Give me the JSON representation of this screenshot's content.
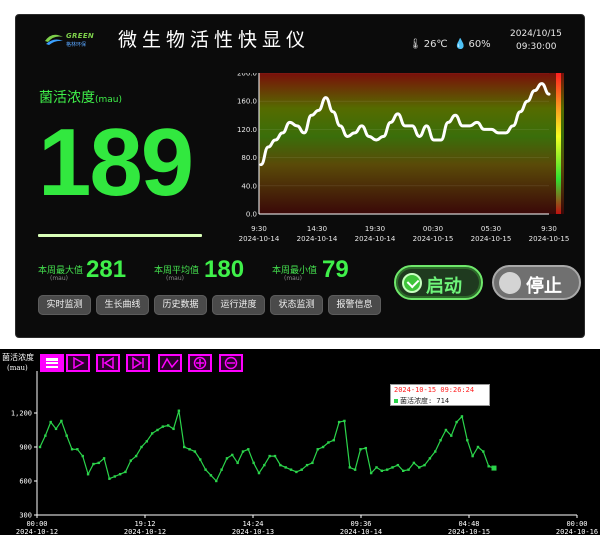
{
  "header": {
    "logo_text": "GREEN",
    "logo_sub": "格林环保",
    "title": "微生物活性快显仪",
    "temperature": "26℃",
    "humidity": "60%",
    "date": "2024/10/15",
    "time": "09:30:00",
    "thermometer_icon": "thermometer-icon",
    "droplet_icon": "droplet-icon"
  },
  "metric": {
    "label": "菌活浓度",
    "unit": "(mau)",
    "value": "189"
  },
  "stats": [
    {
      "label": "本周最大值",
      "unit": "(mau)",
      "value": "281"
    },
    {
      "label": "本周平均值",
      "unit": "(mau)",
      "value": "180"
    },
    {
      "label": "本周最小值",
      "unit": "(mau)",
      "value": "79"
    }
  ],
  "nav": [
    "实时监测",
    "生长曲线",
    "历史数据",
    "运行进度",
    "状态监测",
    "报警信息"
  ],
  "controls": {
    "start_label": "启动",
    "stop_label": "停止"
  },
  "colors": {
    "accent_green": "#32e83f",
    "panel_bg": "#0b0b0b",
    "toolbar_magenta": "#ff00ff",
    "series_green": "#2bd44b"
  },
  "chart_data": [
    {
      "type": "line",
      "ylim": [
        0,
        2000
      ],
      "yticks": [
        "0.0",
        "40.0",
        "80.0",
        "120.0",
        "160.0",
        "200.0"
      ],
      "xtick_labels": [
        {
          "time": "9:30",
          "date": "2024-10-14"
        },
        {
          "time": "14:30",
          "date": "2024-10-14"
        },
        {
          "time": "19:30",
          "date": "2024-10-14"
        },
        {
          "time": "00:30",
          "date": "2024-10-15"
        },
        {
          "time": "05:30",
          "date": "2024-10-15"
        },
        {
          "time": "9:30",
          "date": "2024-10-15"
        }
      ],
      "series": [
        {
          "values": [
            700,
            950,
            1050,
            1150,
            1300,
            1250,
            1150,
            1400,
            1470,
            1650,
            1450,
            1250,
            1100,
            1150,
            1250,
            1100,
            1050,
            1100,
            1300,
            1420,
            1250,
            1250,
            1100,
            1250,
            1050,
            1050,
            1300,
            1400,
            1250,
            1250,
            1300,
            1200,
            1200,
            1150,
            1150,
            1250,
            1450,
            1600,
            1750,
            1850,
            1700
          ]
        }
      ],
      "grid": true
    },
    {
      "type": "line",
      "title": "菌活浓度",
      "ylabel": "(mau)",
      "ylim": [
        300,
        1500
      ],
      "yticks": [
        300,
        600,
        900,
        1200
      ],
      "xtick_labels": [
        {
          "time": "00:00",
          "date": "2024-10-12"
        },
        {
          "time": "19:12",
          "date": "2024-10-12"
        },
        {
          "time": "14:24",
          "date": "2024-10-13"
        },
        {
          "time": "09:36",
          "date": "2024-10-14"
        },
        {
          "time": "04:48",
          "date": "2024-10-15"
        },
        {
          "time": "00:00",
          "date": "2024-10-16"
        }
      ],
      "series": [
        {
          "name": "菌活浓度",
          "values": [
            900,
            1000,
            1120,
            1060,
            1130,
            1000,
            880,
            880,
            820,
            660,
            750,
            760,
            800,
            620,
            640,
            660,
            680,
            780,
            820,
            900,
            950,
            1020,
            1050,
            1080,
            1090,
            1060,
            1220,
            900,
            880,
            860,
            790,
            700,
            650,
            600,
            700,
            800,
            830,
            760,
            860,
            880,
            760,
            670,
            740,
            820,
            820,
            740,
            720,
            700,
            680,
            700,
            740,
            760,
            880,
            900,
            940,
            960,
            1120,
            1130,
            720,
            700,
            880,
            890,
            670,
            720,
            690,
            700,
            720,
            740,
            690,
            700,
            760,
            720,
            740,
            800,
            860,
            960,
            1050,
            1000,
            1120,
            1170,
            960,
            820,
            900,
            860,
            730,
            714
          ]
        }
      ],
      "tooltip": {
        "datetime": "2024-10-15 09:26:24",
        "label": "菌活浓度: 714"
      },
      "grid": false
    }
  ]
}
